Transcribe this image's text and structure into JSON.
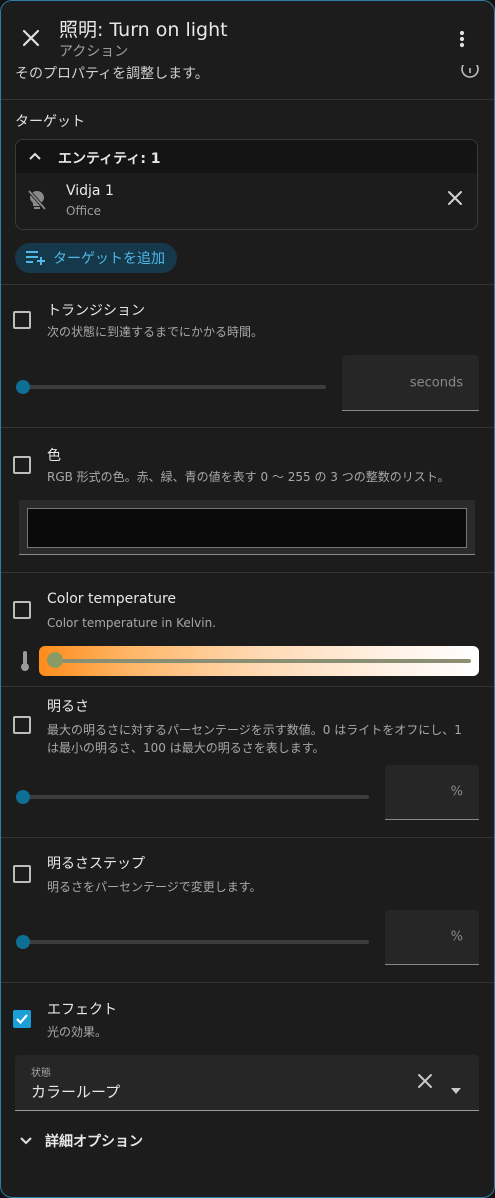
{
  "header": {
    "title": "照明: Turn on light",
    "subtitle": "アクション",
    "cut_text": "そのプロパティを調整します。"
  },
  "target": {
    "label": "ターゲット",
    "group_label": "エンティティ: 1",
    "entity_name": "Vidja 1",
    "entity_area": "Office",
    "add_button": "ターゲットを追加"
  },
  "transition": {
    "title": "トランジション",
    "desc": "次の状態に到達するまでにかかる時間。",
    "value": 0,
    "suffix": "seconds",
    "checked": false
  },
  "color": {
    "title": "色",
    "desc": "RGB 形式の色。赤、緑、青の値を表す 0 〜 255 の 3 つの整数のリスト。",
    "value": "#0a0a0a",
    "checked": false
  },
  "color_temp": {
    "title": "Color temperature",
    "desc": "Color temperature in Kelvin.",
    "level": 0,
    "checked": false
  },
  "brightness": {
    "title": "明るさ",
    "desc": "最大の明るさに対するパーセンテージを示す数値。0 はライトをオフにし、1 は最小の明るさ、100 は最大の明るさを表します。",
    "value": 0,
    "suffix": "%",
    "checked": false
  },
  "brightness_step": {
    "title": "明るさステップ",
    "desc": "明るさをパーセンテージで変更します。",
    "value": 0,
    "suffix": "%",
    "checked": false
  },
  "effect": {
    "title": "エフェクト",
    "desc": "光の効果。",
    "checked": true,
    "select_label": "状態",
    "select_value": "カラーループ"
  },
  "advanced": {
    "label": "詳細オプション"
  },
  "colors": {
    "accent": "#1aa0d6",
    "background": "#1c1c1c",
    "border": "#2e7fa6"
  }
}
